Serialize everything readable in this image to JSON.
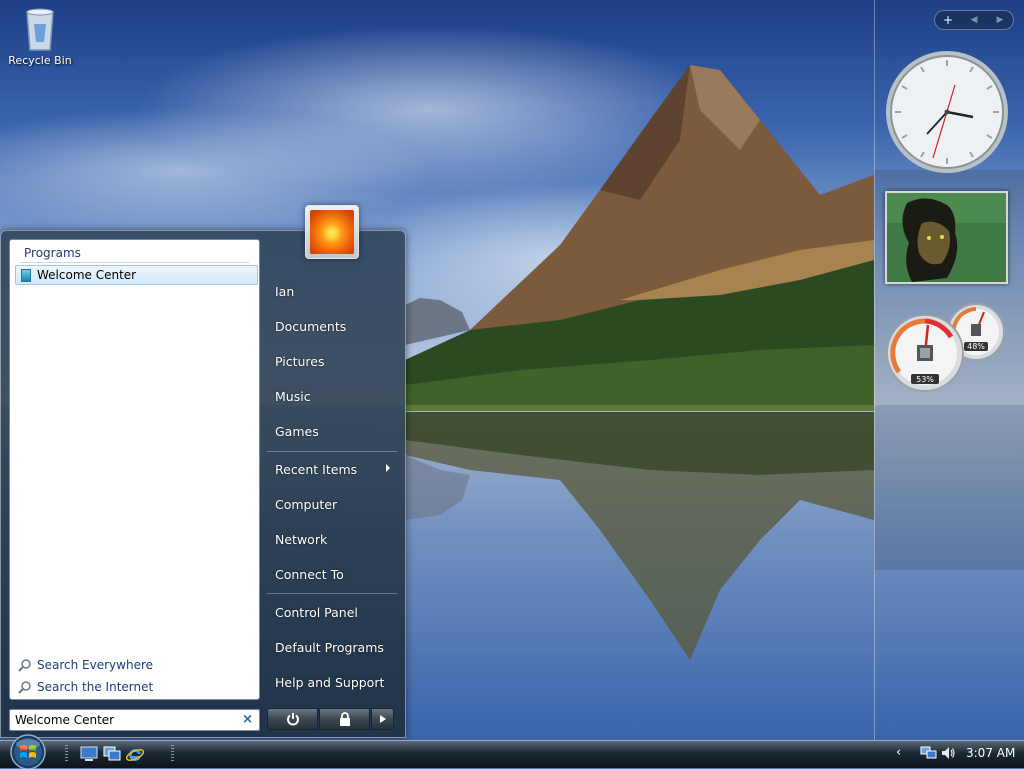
{
  "desktop": {
    "recycle_bin_label": "Recycle Bin"
  },
  "gadget_bar": {
    "add_label": "+",
    "prev_label": "◀",
    "next_label": "▶"
  },
  "meters": {
    "cpu_percent": "53%",
    "memory_percent": "48%"
  },
  "start_menu": {
    "programs_label": "Programs",
    "programs": [
      {
        "label": "Welcome Center"
      }
    ],
    "search_links": [
      {
        "label": "Search Everywhere"
      },
      {
        "label": "Search the Internet"
      }
    ],
    "search_box": {
      "value": "Welcome Center",
      "clear": "×"
    },
    "right_items": [
      {
        "label": "Ian"
      },
      {
        "label": "Documents"
      },
      {
        "label": "Pictures"
      },
      {
        "label": "Music"
      },
      {
        "label": "Games"
      },
      {
        "label": "Recent Items"
      },
      {
        "label": "Computer"
      },
      {
        "label": "Network"
      },
      {
        "label": "Connect To"
      },
      {
        "label": "Control Panel"
      },
      {
        "label": "Default Programs"
      },
      {
        "label": "Help and Support"
      }
    ]
  },
  "taskbar": {
    "tray_chevron": "‹",
    "clock": "3:07 AM"
  },
  "colors": {
    "accent": "#1e3c78",
    "selection": "#d4e8fb"
  }
}
